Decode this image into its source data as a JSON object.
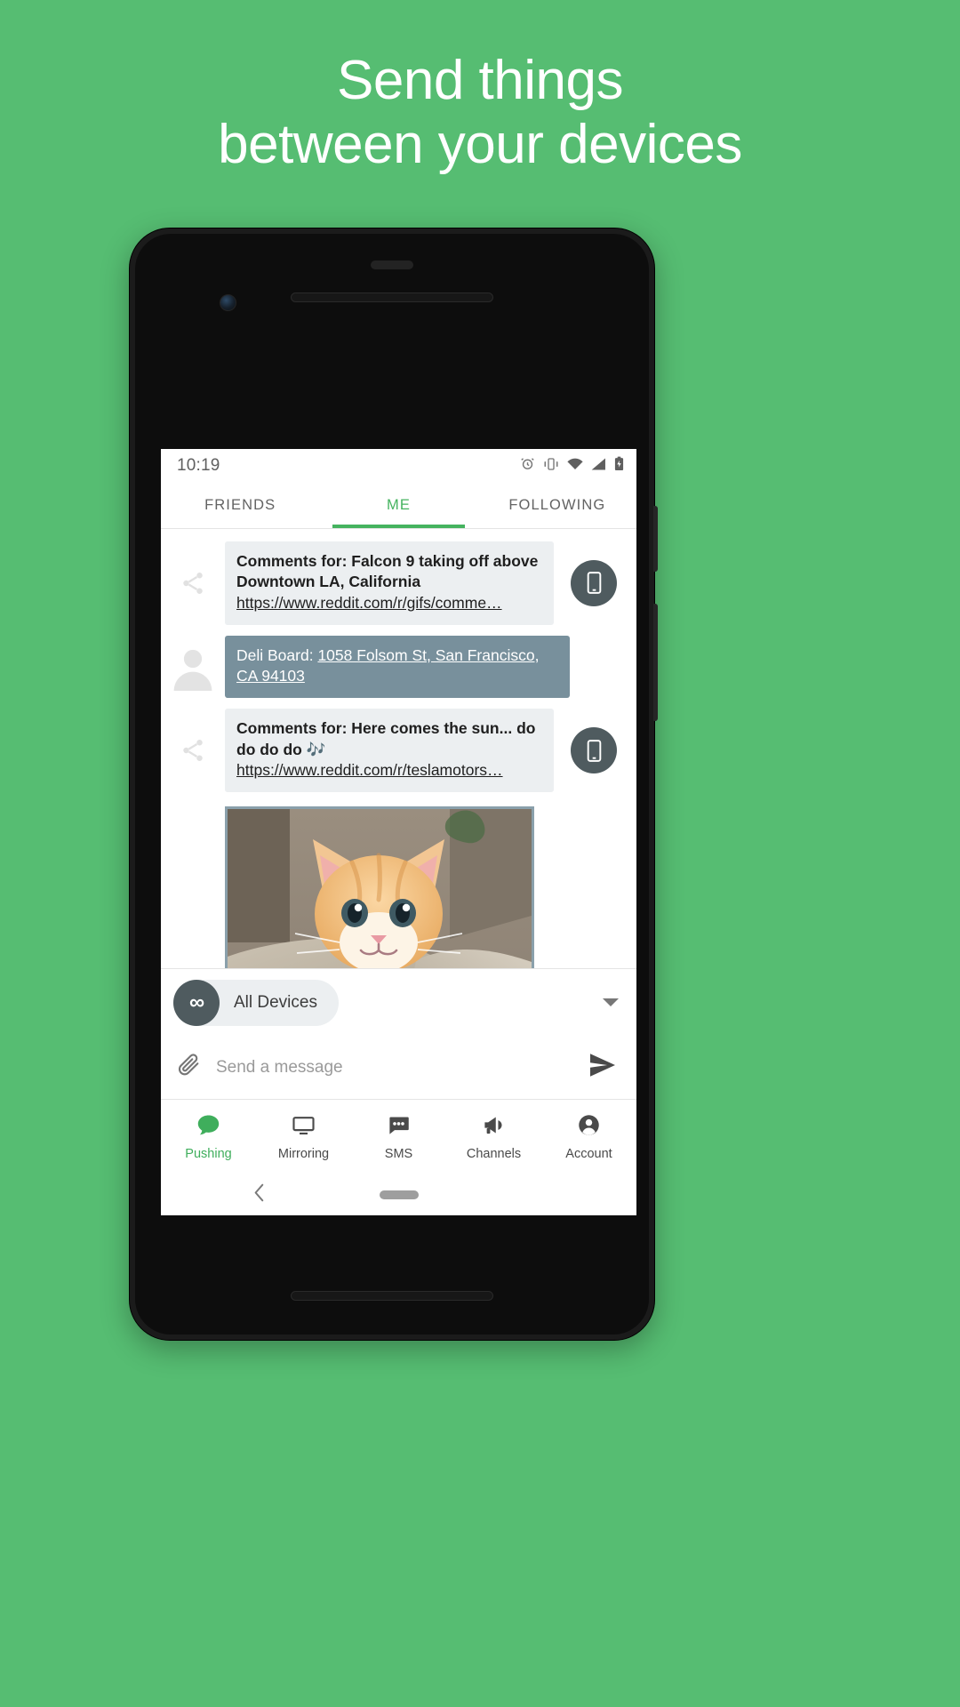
{
  "promo": {
    "headline_line1": "Send things",
    "headline_line2": "between your devices",
    "background_color": "#56bd72",
    "text_color": "#ffffff"
  },
  "statusbar": {
    "time": "10:19",
    "icons": [
      "alarm-icon",
      "vibrate-icon",
      "wifi-icon",
      "signal-icon",
      "battery-icon"
    ]
  },
  "tabs": [
    {
      "label": "FRIENDS",
      "active": false
    },
    {
      "label": "ME",
      "active": true
    },
    {
      "label": "FOLLOWING",
      "active": false
    }
  ],
  "accent_color": "#45b35f",
  "messages": [
    {
      "kind": "link",
      "avatar_icon": "share-icon",
      "title": "Comments for: Falcon 9 taking off above Downtown LA, California",
      "link": "https://www.reddit.com/r/gifs/comme…",
      "bubble_style": "light",
      "badge_icon": "phone-device-icon"
    },
    {
      "kind": "address",
      "avatar_icon": "person-icon",
      "text_prefix": "Deli Board: ",
      "address": "1058 Folsom St, San Francisco, CA 94103",
      "bubble_style": "slate"
    },
    {
      "kind": "link",
      "avatar_icon": "share-icon",
      "title": "Comments for: Here comes the sun... do do do do 🎶",
      "link": "https://www.reddit.com/r/teslamotors…",
      "bubble_style": "light",
      "badge_icon": "phone-device-icon"
    },
    {
      "kind": "image",
      "alt": "photo of a ginger kitten on a couch",
      "share_icon": "share-icon"
    }
  ],
  "device_selector": {
    "icon": "all-devices-infinity-icon",
    "label": "All Devices",
    "caret": "chevron-down-icon"
  },
  "composer": {
    "attach_icon": "paperclip-icon",
    "placeholder": "Send a message",
    "value": "",
    "send_icon": "send-icon"
  },
  "bottom_nav": [
    {
      "label": "Pushing",
      "icon": "chat-bubble-icon",
      "active": true
    },
    {
      "label": "Mirroring",
      "icon": "monitor-icon",
      "active": false
    },
    {
      "label": "SMS",
      "icon": "sms-dots-icon",
      "active": false
    },
    {
      "label": "Channels",
      "icon": "megaphone-icon",
      "active": false
    },
    {
      "label": "Account",
      "icon": "account-icon",
      "active": false
    }
  ],
  "system_bar": {
    "back_icon": "back-chevron-icon",
    "home_pill": "home-pill"
  }
}
